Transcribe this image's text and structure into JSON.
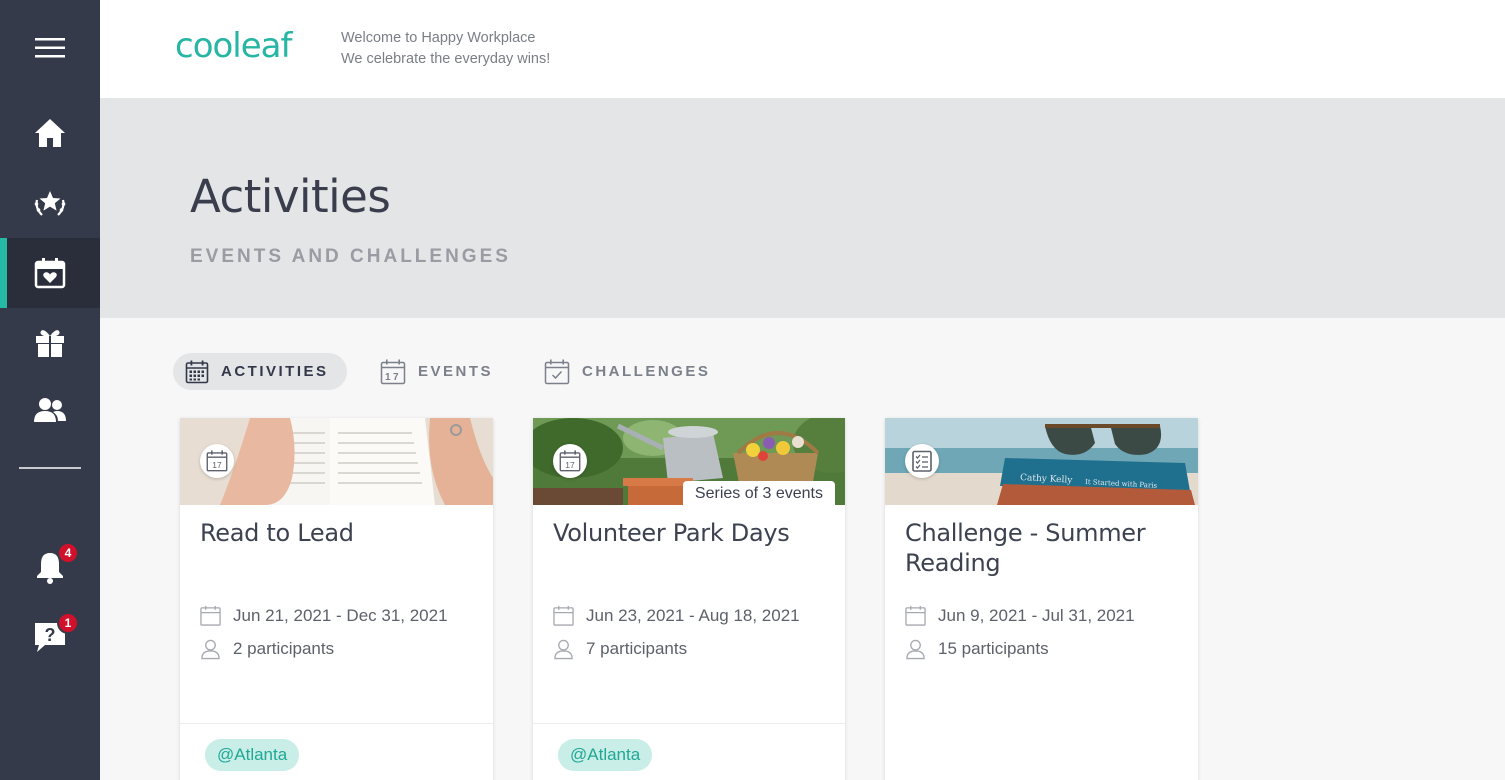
{
  "app": {
    "logo_text": "cooleaf",
    "welcome_line1": "Welcome to Happy Workplace",
    "welcome_line2": "We celebrate the everyday wins!",
    "accent_color": "#25b9a6",
    "badge_color": "#d0112b"
  },
  "sidebar": {
    "items": [
      {
        "name": "menu",
        "icon": "hamburger-icon"
      },
      {
        "name": "home",
        "icon": "home-icon"
      },
      {
        "name": "recognition",
        "icon": "star-laurel-icon"
      },
      {
        "name": "activities",
        "icon": "calendar-heart-icon",
        "active": true
      },
      {
        "name": "rewards",
        "icon": "gift-icon"
      },
      {
        "name": "people",
        "icon": "users-icon"
      },
      {
        "name": "notifications",
        "icon": "bell-icon",
        "badge": "4"
      },
      {
        "name": "help",
        "icon": "help-chat-icon",
        "badge": "1"
      }
    ]
  },
  "hero": {
    "title": "Activities",
    "subtitle": "EVENTS AND CHALLENGES"
  },
  "tabs": [
    {
      "label": "ACTIVITIES",
      "icon": "calendar-grid-icon",
      "active": true
    },
    {
      "label": "EVENTS",
      "icon": "calendar-17-icon",
      "active": false
    },
    {
      "label": "CHALLENGES",
      "icon": "calendar-check-icon",
      "active": false
    }
  ],
  "cards": [
    {
      "title": "Read to Lead",
      "type_icon": "calendar-17-icon",
      "image": "hands-reading-book",
      "dates": "Jun 21, 2021 - Dec 31, 2021",
      "participants": "2 participants",
      "tag": "@Atlanta"
    },
    {
      "title": "Volunteer Park Days",
      "type_icon": "calendar-17-icon",
      "image": "garden-watering-can-flowers",
      "series_label": "Series of 3 events",
      "dates": "Jun 23, 2021 - Aug 18, 2021",
      "participants": "7 participants",
      "tag": "@Atlanta"
    },
    {
      "title": "Challenge - Summer Reading",
      "type_icon": "checklist-icon",
      "image": "sunglasses-on-books-beach",
      "dates": "Jun 9, 2021 - Jul 31, 2021",
      "participants": "15 participants"
    }
  ]
}
